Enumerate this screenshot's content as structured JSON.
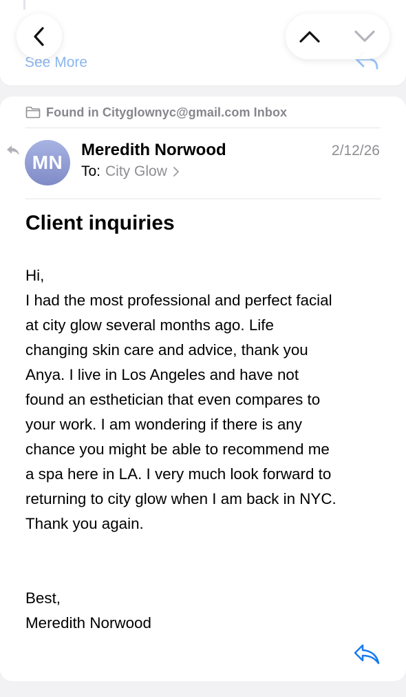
{
  "previous_message": {
    "see_more_label": "See More"
  },
  "top_bar": {
    "back_icon": "chevron-left-icon",
    "prev_message_icon": "chevron-up-icon",
    "next_message_icon": "chevron-down-icon"
  },
  "message": {
    "found_in": "Found in Cityglownyc@gmail.com Inbox",
    "avatar_initials": "MN",
    "sender_name": "Meredith Norwood",
    "to_label": "To:",
    "to_name": "City Glow",
    "date": "2/12/26",
    "subject": "Client inquiries",
    "body_lines": [
      "Hi,",
      "I had the most professional and perfect facial",
      "at city glow several months ago. Life",
      "changing skin care and advice, thank you",
      "Anya.  I live in Los Angeles and have not",
      "found an esthetician that even compares to",
      "your work. I am wondering if there is any",
      "chance you might be able to recommend me",
      "a spa here in LA. I very much look forward to",
      "returning to city glow when I am back in NYC.",
      "Thank you again."
    ],
    "closing_lines": [
      "Best,",
      "Meredith Norwood"
    ]
  },
  "colors": {
    "accent_blue": "#1a7cf0",
    "secondary_gray": "#8e8e93",
    "avatar_gradient_top": "#a8b3e3",
    "avatar_gradient_bottom": "#7f8bc6"
  }
}
